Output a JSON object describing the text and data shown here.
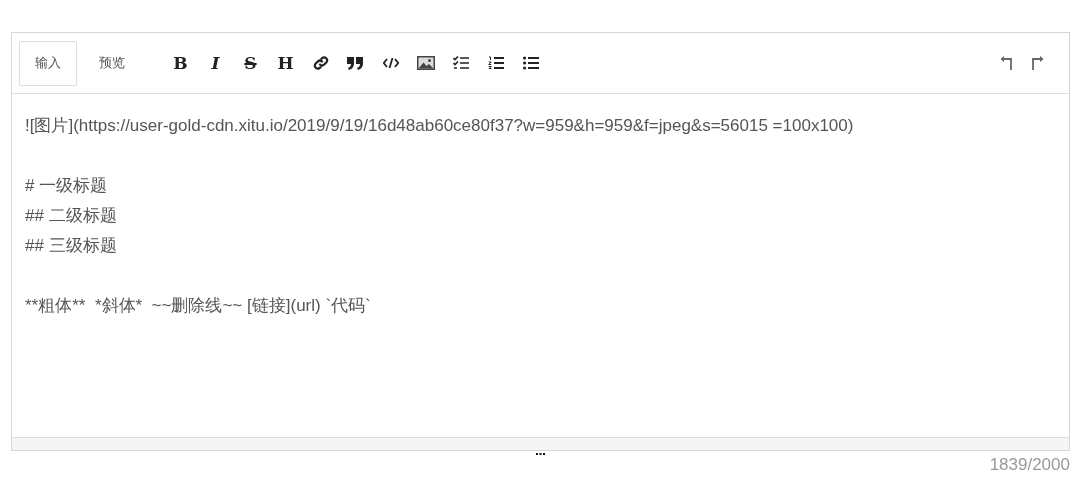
{
  "tabs": [
    {
      "label": "输入",
      "selected": true
    },
    {
      "label": "预览",
      "selected": false
    }
  ],
  "tools": [
    {
      "kind": "bold",
      "glyph": "B"
    },
    {
      "kind": "italic",
      "glyph": "I"
    },
    {
      "kind": "strike",
      "glyph": "S"
    },
    {
      "kind": "heading",
      "glyph": "H"
    },
    {
      "kind": "link"
    },
    {
      "kind": "quote"
    },
    {
      "kind": "code"
    },
    {
      "kind": "image"
    },
    {
      "kind": "tasklist"
    },
    {
      "kind": "orderedlist"
    },
    {
      "kind": "bulletlist"
    }
  ],
  "history": [
    {
      "kind": "undo"
    },
    {
      "kind": "redo"
    }
  ],
  "editor": {
    "value": "![图片](https://user-gold-cdn.xitu.io/2019/9/19/16d48ab60ce80f37?w=959&h=959&f=jpeg&s=56015 =100x100)\n\n# 一级标题\n## 二级标题\n## 三级标题\n\n**粗体**  *斜体*  ~~删除线~~ [链接](url) `代码`"
  },
  "counter": "1839/2000"
}
